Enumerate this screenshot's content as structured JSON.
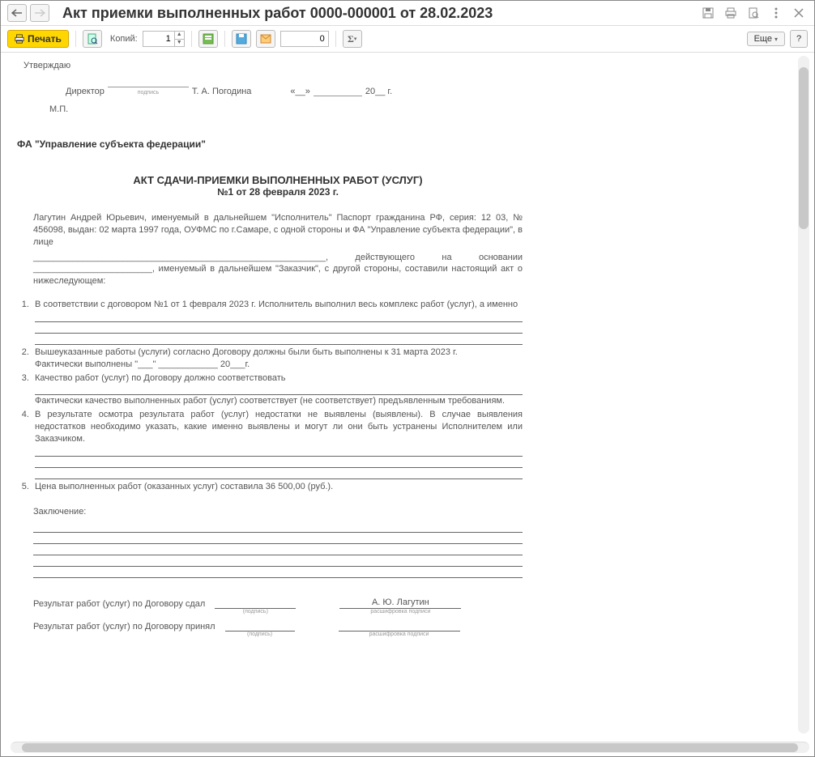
{
  "title": "Акт приемки выполненных работ 0000-000001 от 28.02.2023",
  "toolbar": {
    "print_label": "Печать",
    "copies_label": "Копий:",
    "copies_value": "1",
    "zero_value": "0",
    "more_label": "Еще",
    "help_label": "?"
  },
  "doc": {
    "approve": "Утверждаю",
    "director_label": "Директор",
    "director_name": "Т. А. Погодина",
    "date_quote_open": "«__»",
    "date_year": "20__ г.",
    "mp": "М.П.",
    "org": "ФА \"Управление субъекта федерации\"",
    "title": "АКТ  СДАЧИ-ПРИЕМКИ ВЫПОЛНЕННЫХ РАБОТ (УСЛУГ)",
    "subtitle": "№1 от 28 февраля 2023 г.",
    "p1a": "Лагутин Андрей Юрьевич, именуемый в дальнейшем \"Исполнитель\" Паспорт гражданина РФ, серия: 12 03, № 456098, выдан: 02 марта 1997 года, ОУФМС по г.Самаре, с одной стороны и ФА \"Управление субъекта федерации\", в лице",
    "p1b": "___________________________________________________________, действующего на основании ________________________, именуемый в дальнейшем \"Заказчик\", с другой стороны, составили настоящий акт о нижеследующем:",
    "li1": "В соответствии с договором №1 от 1 февраля 2023 г. Исполнитель выполнил весь комплекс работ (услуг), а именно",
    "li2a": "Вышеуказанные работы (услуги) согласно Договору должны были быть выполнены к 31 марта 2023 г.",
    "li2b": "Фактически выполнены \"___\" ____________ 20___г.",
    "li3a": "Качество работ (услуг) по Договору должно соответствовать",
    "li3b": "Фактически качество выполненных работ (услуг) соответствует (не соответствует) предъявленным требованиям.",
    "li4": "В результате осмотра результата работ (услуг) недостатки не выявлены (выявлены). В случае выявления недостатков необходимо указать, какие именно выявлены и могут ли они быть устранены Исполнителем или Заказчиком.",
    "li5": "Цена выполненных работ (оказанных услуг) составила 36 500,00 (руб.).",
    "conclusion": "Заключение:",
    "sign1_label": "Результат работ (услуг) по Договору сдал",
    "sign1_name": "А. Ю. Лагутин",
    "sign2_label": "Результат работ (услуг) по Договору принял",
    "below_sign": "(подпись)",
    "below_name": "расшифровка подписи",
    "podpis": "подпись"
  }
}
